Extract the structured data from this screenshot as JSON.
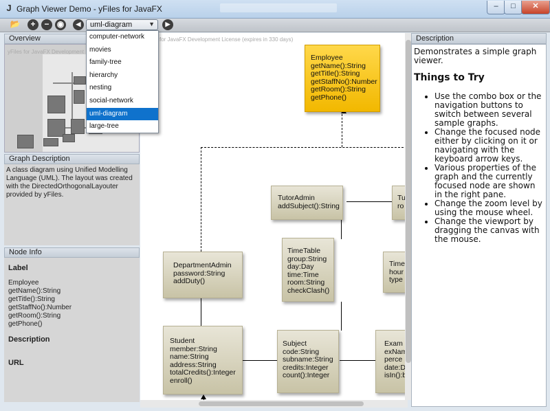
{
  "window": {
    "title": "Graph Viewer Demo - yFiles for JavaFX",
    "minimize": "–",
    "maximize": "□",
    "close": "✕"
  },
  "toolbar": {
    "open_icon": "📂",
    "zoom_in": "+",
    "zoom_out": "−",
    "fit": "◉",
    "prev": "◀",
    "next": "▶",
    "combo_value": "uml-diagram",
    "combo_arrow": "▼"
  },
  "dropdown": {
    "options": [
      "computer-network",
      "movies",
      "family-tree",
      "hierarchy",
      "nesting",
      "social-network",
      "uml-diagram",
      "large-tree"
    ],
    "selected": "uml-diagram"
  },
  "left": {
    "overview_label": "Overview",
    "overview_note": "yFiles for JavaFX Development License",
    "graph_desc_label": "Graph Description",
    "graph_desc": "A class diagram using Unified Modelling Language (UML). The layout was created with the DirectedOrthogonalLayouter provided by yFiles.",
    "node_info_label": "Node Info",
    "label_heading": "Label",
    "label_lines": [
      "Employee",
      "getName():String",
      "getTitle():String",
      "getStaffNo():Number",
      "getRoom():String",
      "getPhone()"
    ],
    "description_heading": "Description",
    "url_heading": "URL"
  },
  "canvas": {
    "license": "for JavaFX Development License (expires in 330 days)",
    "nodes": {
      "employee": "Employee\ngetName():String\ngetTitle():String\ngetStaffNo():Number\ngetRoom():String\ngetPhone()",
      "tutor_admin": "TutorAdmin\naddSubject():String",
      "tutor_partial": "Tu\nro",
      "department_admin": "DepartmentAdmin\npassword:String\naddDuty()",
      "timetable": "TimeTable\ngroup:String\nday:Day\ntime:Time\nroom:String\ncheckClash()",
      "time_partial": "Time\nhour\ntype",
      "student": "Student\nmember:String\nname:String\naddress:String\ntotalCredits():Integer\nenroll()",
      "subject": "Subject\ncode:String\nsubname:String\ncredits:Integer\ncount():Integer",
      "exam_partial": "Exam\nexNam\nperce\ndate:D\nisIn():b"
    }
  },
  "right": {
    "header": "Description",
    "intro": "Demonstrates a simple graph viewer.",
    "things_heading": "Things to Try",
    "tips": [
      "Use the combo box or the navigation buttons to switch between several sample graphs.",
      "Change the focused node either by clicking on it or navigating with the keyboard arrow keys.",
      "Various properties of the graph and the currently focused node are shown in the right pane.",
      "Change the zoom level by using the mouse wheel.",
      "Change the viewport by dragging the canvas with the mouse."
    ]
  },
  "colors": {
    "selected_node": "#f5c000",
    "node": "#cfcab0",
    "menu_highlight": "#0f72cc"
  }
}
